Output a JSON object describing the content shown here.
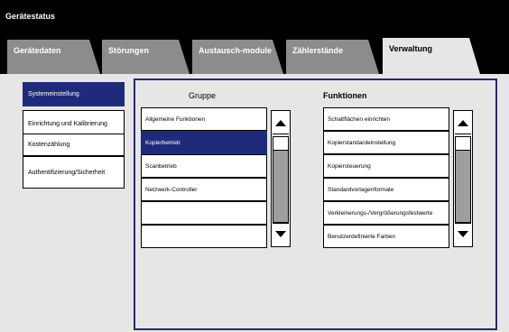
{
  "window": {
    "title": "Gerätestatus"
  },
  "tabs": [
    {
      "label": "Gerätedaten"
    },
    {
      "label": "Störungen"
    },
    {
      "label": "Austausch-module"
    },
    {
      "label": "Zählerstände"
    },
    {
      "label": "Verwaltung",
      "active": true
    }
  ],
  "sidebar": {
    "items": [
      {
        "label": "Systemeinstellung",
        "selected": true
      },
      {
        "label": "Einrichtung und Kalibrierung"
      },
      {
        "label": "Kostenzählung"
      },
      {
        "label": "Authentifizierung/Sicherheit"
      }
    ]
  },
  "group": {
    "header": "Gruppe",
    "items": [
      {
        "label": "Allgemeine Funktionen"
      },
      {
        "label": "Kopierbetrieb",
        "selected": true
      },
      {
        "label": "Scanbetrieb"
      },
      {
        "label": "Netzwerk-Controller"
      },
      {
        "label": ""
      },
      {
        "label": ""
      }
    ]
  },
  "functions": {
    "header": "Funktionen",
    "items": [
      {
        "label": "Schaltflächen einrichten"
      },
      {
        "label": "Kopierstandardeinstellung"
      },
      {
        "label": "Kopiersteuerung"
      },
      {
        "label": "Standardvorlagenformate"
      },
      {
        "label": "Verkleinerungs-/Vergrößerungsfestwerte"
      },
      {
        "label": "Benutzerdefinierte Farben"
      }
    ]
  },
  "colors": {
    "accent": "#1f2a7a",
    "tab": "#8c8c8c",
    "panel": "#e6e6e6"
  }
}
